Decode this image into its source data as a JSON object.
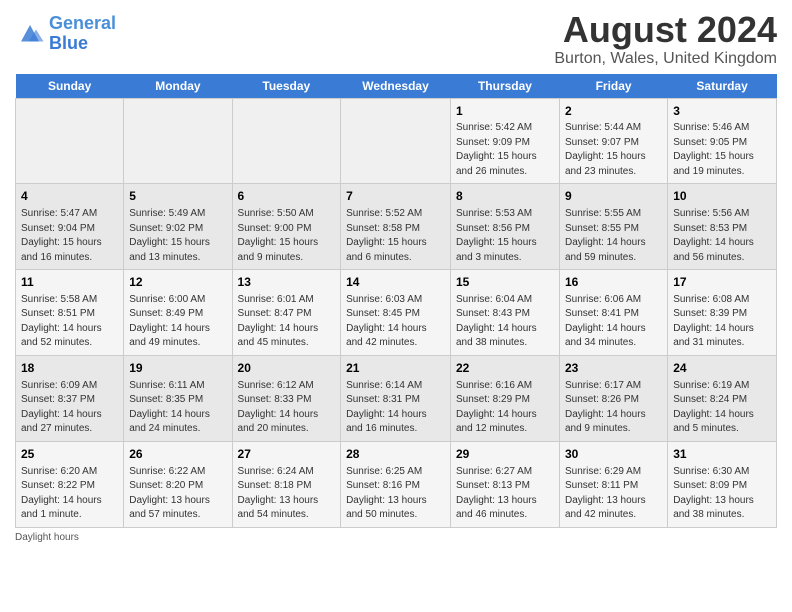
{
  "header": {
    "logo_line1": "General",
    "logo_line2": "Blue",
    "main_title": "August 2024",
    "subtitle": "Burton, Wales, United Kingdom"
  },
  "days_of_week": [
    "Sunday",
    "Monday",
    "Tuesday",
    "Wednesday",
    "Thursday",
    "Friday",
    "Saturday"
  ],
  "weeks": [
    [
      {
        "day": "",
        "info": ""
      },
      {
        "day": "",
        "info": ""
      },
      {
        "day": "",
        "info": ""
      },
      {
        "day": "",
        "info": ""
      },
      {
        "day": "1",
        "info": "Sunrise: 5:42 AM\nSunset: 9:09 PM\nDaylight: 15 hours\nand 26 minutes."
      },
      {
        "day": "2",
        "info": "Sunrise: 5:44 AM\nSunset: 9:07 PM\nDaylight: 15 hours\nand 23 minutes."
      },
      {
        "day": "3",
        "info": "Sunrise: 5:46 AM\nSunset: 9:05 PM\nDaylight: 15 hours\nand 19 minutes."
      }
    ],
    [
      {
        "day": "4",
        "info": "Sunrise: 5:47 AM\nSunset: 9:04 PM\nDaylight: 15 hours\nand 16 minutes."
      },
      {
        "day": "5",
        "info": "Sunrise: 5:49 AM\nSunset: 9:02 PM\nDaylight: 15 hours\nand 13 minutes."
      },
      {
        "day": "6",
        "info": "Sunrise: 5:50 AM\nSunset: 9:00 PM\nDaylight: 15 hours\nand 9 minutes."
      },
      {
        "day": "7",
        "info": "Sunrise: 5:52 AM\nSunset: 8:58 PM\nDaylight: 15 hours\nand 6 minutes."
      },
      {
        "day": "8",
        "info": "Sunrise: 5:53 AM\nSunset: 8:56 PM\nDaylight: 15 hours\nand 3 minutes."
      },
      {
        "day": "9",
        "info": "Sunrise: 5:55 AM\nSunset: 8:55 PM\nDaylight: 14 hours\nand 59 minutes."
      },
      {
        "day": "10",
        "info": "Sunrise: 5:56 AM\nSunset: 8:53 PM\nDaylight: 14 hours\nand 56 minutes."
      }
    ],
    [
      {
        "day": "11",
        "info": "Sunrise: 5:58 AM\nSunset: 8:51 PM\nDaylight: 14 hours\nand 52 minutes."
      },
      {
        "day": "12",
        "info": "Sunrise: 6:00 AM\nSunset: 8:49 PM\nDaylight: 14 hours\nand 49 minutes."
      },
      {
        "day": "13",
        "info": "Sunrise: 6:01 AM\nSunset: 8:47 PM\nDaylight: 14 hours\nand 45 minutes."
      },
      {
        "day": "14",
        "info": "Sunrise: 6:03 AM\nSunset: 8:45 PM\nDaylight: 14 hours\nand 42 minutes."
      },
      {
        "day": "15",
        "info": "Sunrise: 6:04 AM\nSunset: 8:43 PM\nDaylight: 14 hours\nand 38 minutes."
      },
      {
        "day": "16",
        "info": "Sunrise: 6:06 AM\nSunset: 8:41 PM\nDaylight: 14 hours\nand 34 minutes."
      },
      {
        "day": "17",
        "info": "Sunrise: 6:08 AM\nSunset: 8:39 PM\nDaylight: 14 hours\nand 31 minutes."
      }
    ],
    [
      {
        "day": "18",
        "info": "Sunrise: 6:09 AM\nSunset: 8:37 PM\nDaylight: 14 hours\nand 27 minutes."
      },
      {
        "day": "19",
        "info": "Sunrise: 6:11 AM\nSunset: 8:35 PM\nDaylight: 14 hours\nand 24 minutes."
      },
      {
        "day": "20",
        "info": "Sunrise: 6:12 AM\nSunset: 8:33 PM\nDaylight: 14 hours\nand 20 minutes."
      },
      {
        "day": "21",
        "info": "Sunrise: 6:14 AM\nSunset: 8:31 PM\nDaylight: 14 hours\nand 16 minutes."
      },
      {
        "day": "22",
        "info": "Sunrise: 6:16 AM\nSunset: 8:29 PM\nDaylight: 14 hours\nand 12 minutes."
      },
      {
        "day": "23",
        "info": "Sunrise: 6:17 AM\nSunset: 8:26 PM\nDaylight: 14 hours\nand 9 minutes."
      },
      {
        "day": "24",
        "info": "Sunrise: 6:19 AM\nSunset: 8:24 PM\nDaylight: 14 hours\nand 5 minutes."
      }
    ],
    [
      {
        "day": "25",
        "info": "Sunrise: 6:20 AM\nSunset: 8:22 PM\nDaylight: 14 hours\nand 1 minute."
      },
      {
        "day": "26",
        "info": "Sunrise: 6:22 AM\nSunset: 8:20 PM\nDaylight: 13 hours\nand 57 minutes."
      },
      {
        "day": "27",
        "info": "Sunrise: 6:24 AM\nSunset: 8:18 PM\nDaylight: 13 hours\nand 54 minutes."
      },
      {
        "day": "28",
        "info": "Sunrise: 6:25 AM\nSunset: 8:16 PM\nDaylight: 13 hours\nand 50 minutes."
      },
      {
        "day": "29",
        "info": "Sunrise: 6:27 AM\nSunset: 8:13 PM\nDaylight: 13 hours\nand 46 minutes."
      },
      {
        "day": "30",
        "info": "Sunrise: 6:29 AM\nSunset: 8:11 PM\nDaylight: 13 hours\nand 42 minutes."
      },
      {
        "day": "31",
        "info": "Sunrise: 6:30 AM\nSunset: 8:09 PM\nDaylight: 13 hours\nand 38 minutes."
      }
    ]
  ],
  "footer": {
    "text": "Daylight hours"
  }
}
